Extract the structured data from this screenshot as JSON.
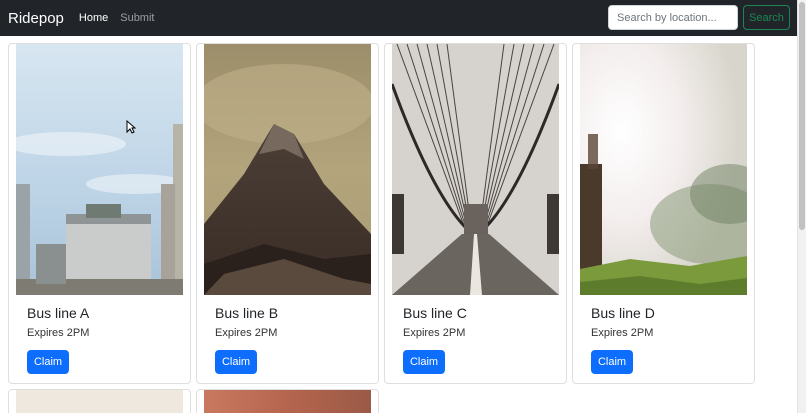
{
  "navbar": {
    "brand": "Ridepop",
    "links": [
      {
        "label": "Home",
        "active": true
      },
      {
        "label": "Submit",
        "active": false
      }
    ],
    "search": {
      "placeholder": "Search by location...",
      "value": "",
      "button_label": "Search"
    }
  },
  "cards": [
    {
      "title": "Bus line A",
      "expires": "Expires 2PM",
      "button_label": "Claim"
    },
    {
      "title": "Bus line B",
      "expires": "Expires 2PM",
      "button_label": "Claim"
    },
    {
      "title": "Bus line C",
      "expires": "Expires 2PM",
      "button_label": "Claim"
    },
    {
      "title": "Bus line D",
      "expires": "Expires 2PM",
      "button_label": "Claim"
    }
  ],
  "colors": {
    "navbar_bg": "#212529",
    "primary": "#0d6efd",
    "success": "#198754"
  }
}
